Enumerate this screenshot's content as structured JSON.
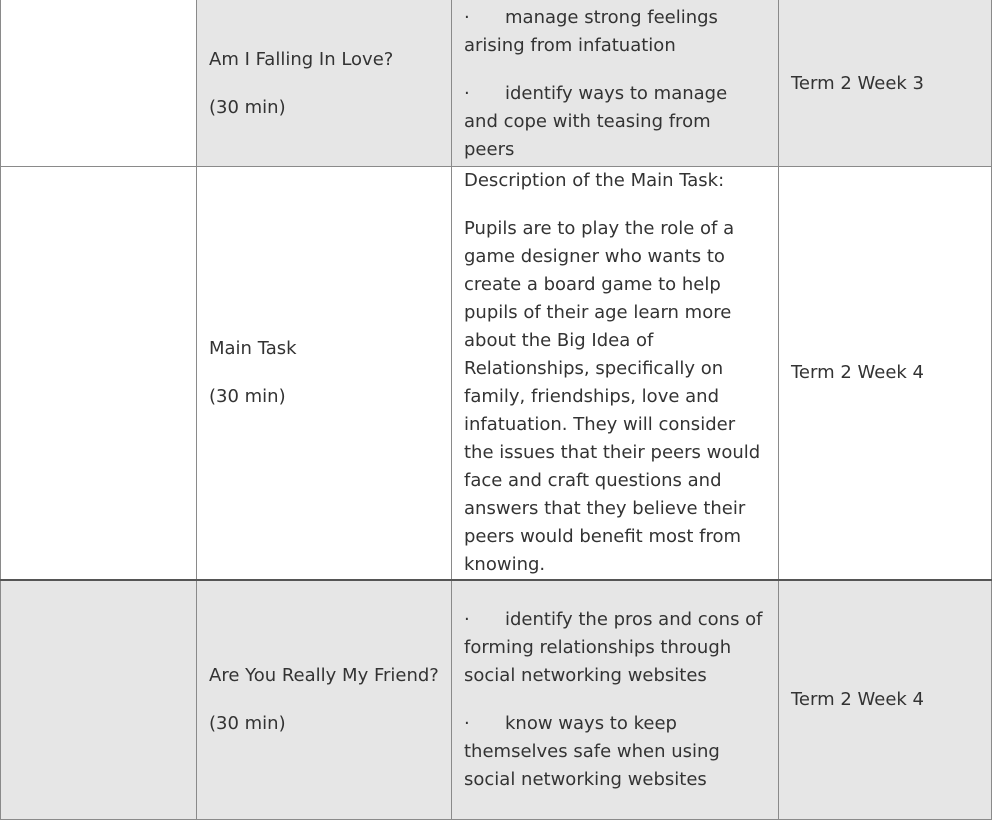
{
  "rows": [
    {
      "lesson_title": "Am I Falling In Love?",
      "duration": "(30 min)",
      "objectives": [
        "manage strong feelings arising from infatuation",
        "identify ways to manage and cope with teasing from peers"
      ],
      "term": "Term 2 Week 3"
    },
    {
      "lesson_title": "Main Task",
      "duration": "(30 min)",
      "description_heading": "Description of the Main Task:",
      "description_text": "Pupils are to play the role of a game designer who wants to create a board game to help pupils of their age learn more about the Big Idea of Relationships, specifically on family, friendships, love and infatuation. They will consider the issues that their peers would face and craft questions and answers that they believe their peers would benefit most from knowing.",
      "term": "Term 2 Week 4"
    },
    {
      "lesson_title": "Are You Really My Friend?",
      "duration": "(30 min)",
      "objectives": [
        "identify the pros and cons of forming relationships through social networking websites",
        "know ways to keep themselves safe when using social networking websites"
      ],
      "term": "Term 2 Week 4"
    }
  ],
  "bullet_glyph": "·"
}
